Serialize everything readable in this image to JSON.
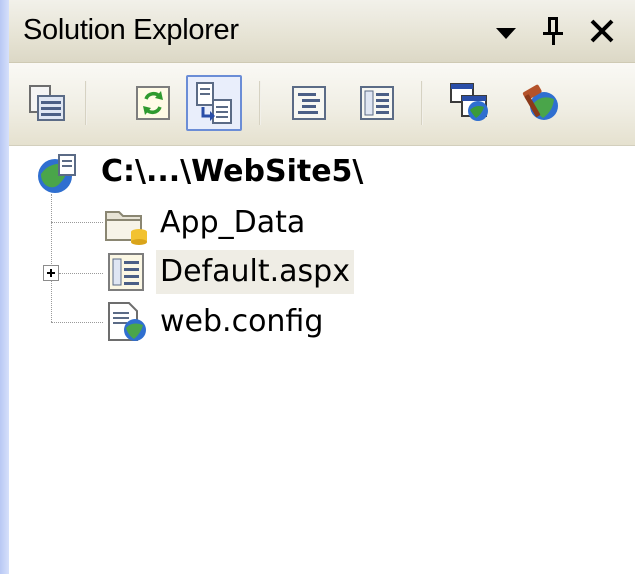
{
  "window": {
    "title": "Solution Explorer",
    "buttons": [
      {
        "name": "window-position-dropdown",
        "icon": "chevron-down-icon"
      },
      {
        "name": "auto-hide-pin",
        "icon": "pin-icon"
      },
      {
        "name": "close",
        "icon": "close-icon"
      }
    ]
  },
  "toolbar": {
    "buttons": [
      {
        "name": "properties",
        "icon": "properties-icon",
        "pressed": false
      },
      {
        "name": "refresh",
        "icon": "refresh-icon",
        "pressed": false
      },
      {
        "name": "nest-related-files",
        "icon": "nest-files-icon",
        "pressed": true
      },
      {
        "name": "view-code",
        "icon": "view-code-icon",
        "pressed": false
      },
      {
        "name": "view-designer",
        "icon": "view-designer-icon",
        "pressed": false
      },
      {
        "name": "copy-web-site",
        "icon": "copy-website-icon",
        "pressed": false
      },
      {
        "name": "asp-net-configuration",
        "icon": "asp-config-icon",
        "pressed": false
      }
    ]
  },
  "tree": {
    "root": {
      "label": "C:\\...\\WebSite5\\",
      "icon": "website-globe-icon"
    },
    "children": [
      {
        "label": "App_Data",
        "icon": "folder-icon",
        "expandable": false,
        "selected": false
      },
      {
        "label": "Default.aspx",
        "icon": "aspx-page-icon",
        "expandable": true,
        "selected": true
      },
      {
        "label": "web.config",
        "icon": "config-file-icon",
        "expandable": false,
        "selected": false
      }
    ]
  }
}
